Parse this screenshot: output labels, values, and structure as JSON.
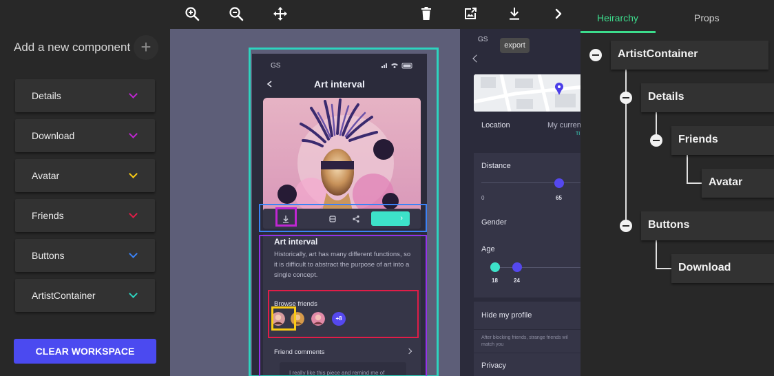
{
  "sidebar": {
    "add_label": "Add a new component",
    "add_icon": "+",
    "items": [
      {
        "label": "Details",
        "chevron_color": "#c026d3"
      },
      {
        "label": "Download",
        "chevron_color": "#c026d3"
      },
      {
        "label": "Avatar",
        "chevron_color": "#facc15"
      },
      {
        "label": "Friends",
        "chevron_color": "#e11d48"
      },
      {
        "label": "Buttons",
        "chevron_color": "#3b82f6"
      },
      {
        "label": "ArtistContainer",
        "chevron_color": "#2dd4bf"
      }
    ],
    "clear_label": "CLEAR WORKSPACE"
  },
  "toolbar": {
    "icons": [
      "zoom-in-icon",
      "zoom-out-icon",
      "move-icon",
      "trash-icon",
      "export-image-icon",
      "download-icon",
      "chevron-right-icon"
    ],
    "tooltip": "export"
  },
  "phone": {
    "status": "GS",
    "title": "Art interval",
    "info_title": "Art interval",
    "info_desc": "Historically, art has many different functions, so it is difficult to abstract the purpose of art into a single concept.",
    "browse_label": "Browse friends",
    "more_friends": "+8",
    "comments_label": "Friend comments",
    "comment_preview": "I really like this piece and remind me of"
  },
  "panel2": {
    "status": "GS",
    "location_label": "Location",
    "location_value": "My curren",
    "location_sub": "TI",
    "distance_label": "Distance",
    "distance_min": "0",
    "distance_value": "65",
    "gender_label": "Gender",
    "age_label": "Age",
    "age_min": "18",
    "age_max": "24",
    "hide_label": "Hide my profile",
    "hide_desc_1": "After blocking friends, strange friends wil",
    "hide_desc_2": "match you",
    "privacy_label": "Privacy"
  },
  "hierarchy": {
    "tabs": [
      "Heirarchy",
      "Props"
    ],
    "active_tab": "Heirarchy",
    "nodes": [
      "ArtistContainer",
      "Details",
      "Friends",
      "Avatar",
      "Buttons",
      "Download"
    ]
  },
  "colors": {
    "accent": "#4b4af0",
    "tab_active": "#3cdc8c",
    "outline_artist": "#2dd4bf",
    "outline_buttons": "#3b82f6",
    "outline_details": "#9333ea",
    "outline_download": "#c026d3",
    "outline_friends": "#e11d48",
    "outline_avatar": "#facc15"
  }
}
